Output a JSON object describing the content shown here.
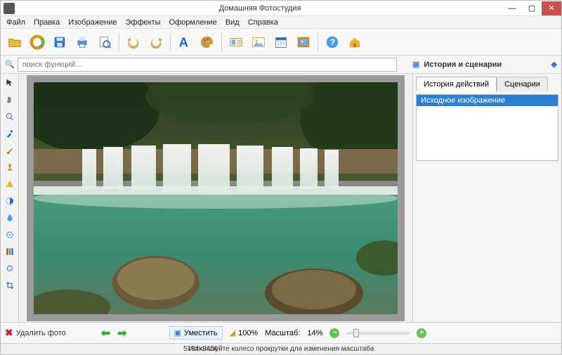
{
  "window": {
    "title": "Домашняя Фотостудия",
    "min": "—",
    "max": "▢",
    "close": "✕"
  },
  "menu": {
    "file": "Файл",
    "edit": "Правка",
    "image": "Изображение",
    "effects": "Эффекты",
    "decoration": "Оформление",
    "view": "Вид",
    "help": "Справка"
  },
  "toolbar_icons": {
    "open": "open",
    "wheel": "wheel",
    "save": "save",
    "print": "print",
    "preview": "preview",
    "undo": "undo",
    "redo": "redo",
    "text": "text",
    "palette": "palette",
    "img1": "img1",
    "img2": "img2",
    "calendar": "calendar",
    "frame": "frame",
    "help": "help",
    "home": "home"
  },
  "search": {
    "placeholder": "поиск функций...",
    "icon": "🔍"
  },
  "rightpanel": {
    "header": "История и сценарии",
    "tab_history": "История действий",
    "tab_scenarios": "Сценарии",
    "history_item": "Исходное изображение",
    "pin": "◆"
  },
  "left_tools": [
    "pointer",
    "hand",
    "zoom",
    "eyedrop",
    "brush",
    "stamp",
    "shape",
    "contrast",
    "blur",
    "sharpen",
    "levels",
    "rotate",
    "crop"
  ],
  "bottom": {
    "delete": "Удалить фото",
    "fit": "Уместить",
    "reset_zoom": "100%",
    "scale_label": "Масштаб:",
    "scale_value": "14%"
  },
  "status": {
    "dims": "5184x3456",
    "hint": "Используйте колесо прокрутки для изменения масштаба"
  }
}
